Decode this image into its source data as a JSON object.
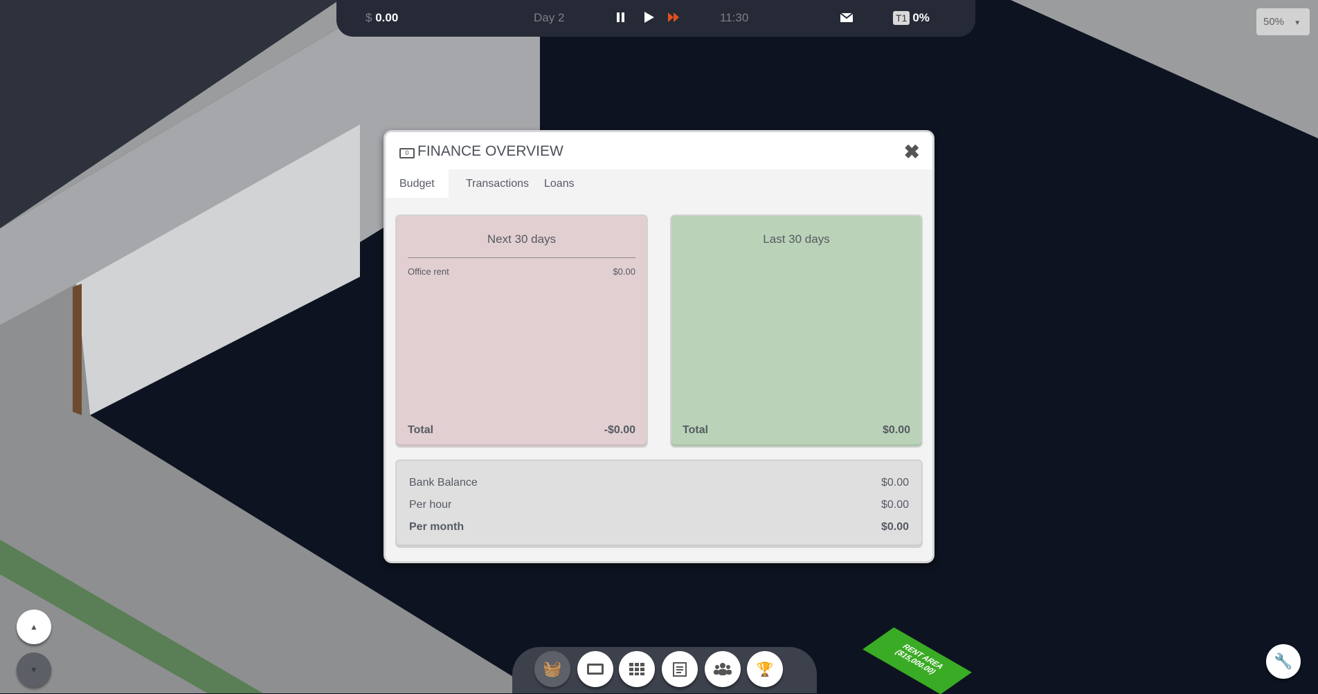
{
  "topbar": {
    "currency": "$",
    "money": "0.00",
    "day": "Day 2",
    "time": "11:30",
    "tier": "T1",
    "percent": "0%"
  },
  "zoom": {
    "value": "50%"
  },
  "modal": {
    "title": "FINANCE OVERVIEW",
    "tabs": [
      {
        "label": "Budget",
        "active": true
      },
      {
        "label": "Transactions"
      },
      {
        "label": "Loans"
      }
    ],
    "next": {
      "title": "Next 30 days",
      "items": [
        {
          "label": "Office rent",
          "value": "$0.00"
        }
      ],
      "total_label": "Total",
      "total": "-$0.00"
    },
    "last": {
      "title": "Last 30 days",
      "total_label": "Total",
      "total": "$0.00"
    },
    "bank": [
      {
        "label": "Bank Balance",
        "value": "$0.00"
      },
      {
        "label": "Per hour",
        "value": "$0.00"
      },
      {
        "label": "Per month",
        "value": "$0.00"
      }
    ]
  },
  "world": {
    "rent_label": "RENT AREA",
    "rent_price": "($15,000.00)"
  },
  "colors": {
    "accent_ff": "#e0501e",
    "rent_green": "#3aab24"
  }
}
